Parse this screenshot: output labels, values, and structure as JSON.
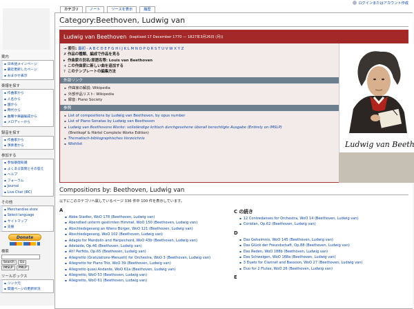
{
  "personal": {
    "login": "ログインまたはアカウント作成"
  },
  "tabs": [
    "カテゴリ",
    "ノート",
    "ソースを表示",
    "履歴"
  ],
  "sidebar": {
    "nav_title": "案内",
    "nav_items": [
      "日本語メインページ",
      "最近更新したページ",
      "おまかせ表示"
    ],
    "browse_title": "楽譜を探す",
    "browse_items": [
      "作曲家から",
      "人名から",
      "国から",
      "時代から",
      "曲種や楽器編成から",
      "メロディーから"
    ],
    "recordings_title": "録音を探す",
    "recordings_items": [
      "作曲家から",
      "演奏者から"
    ],
    "participate_title": "参加する",
    "participate_items": [
      "参加基礎知識",
      "よくある質問とその答え",
      "ヘルプ",
      "フォーラム",
      "Journal",
      "Live Chat (IRC)"
    ],
    "other_title": "その他",
    "other_items": [
      "Merchandise store",
      "Select language",
      "サイトマップ",
      "支援"
    ],
    "donate_label": "Donate",
    "search_title": "検索",
    "search_button": "Search",
    "go_button": "Go",
    "imslp_button": "IMSLP",
    "pmlp_button": "PMLP",
    "toolbox_title": "ツールボックス",
    "toolbox_items": [
      "リンク元",
      "関連ページの更新状況"
    ]
  },
  "page_title": "Category:Beethoven, Ludwig van",
  "infobox": {
    "name": "Ludwig van Beethoven",
    "dates": "(baptised 17 December 1770 — 1827年3月26日 (月))",
    "index_label": "→ 索引:",
    "index_letters": "最初 - A B C D E F G H I J K L M N O P Q R S T U V W X Y Z",
    "genre_label": "作品の種類、編成で作品を見る",
    "alias_label": "作曲家の別名/原語名等:",
    "alias_value": "Louis van Beethoven",
    "add_composer_label": "この作曲家に新しい曲を追加する",
    "template_label": "このテンプレートの編集方法",
    "external_head": "外部リンク",
    "external_items": [
      "作曲家の解説: Wikipedia",
      "外部作品リスト: Wikipedia",
      "録音: Piano Society"
    ],
    "ref_head": "参照",
    "ref_items": [
      "List of compositions by Ludwig van Beethoven, by opus number",
      "List of Piano Sonatas by Ludwig van Beethoven",
      "Ludwig van Beethovens Werke: vollständige kritisch durchgesehene überall berechtigte Ausgabe (Entirely on IMSLP)",
      "(Breitkopf & Härtel Complete Works Edition)",
      "Thematisch-bibliographisches Verzeichnis",
      "Wishlist"
    ]
  },
  "compositions": {
    "title": "Compositions by: Beethoven, Ludwig van",
    "summary": "以下にこのカテゴリへ属しているページ 336 件中 100 件を表示しています。",
    "col1_head": "A",
    "col1_items": [
      "Abbe Stadler, WoO 178 (Beethoven, Ludwig van)",
      "Abendlied unterm gestirnten Himmel, WoO 150 (Beethoven, Ludwig van)",
      "Abschiedsgesang an Wiens Bürger, WoO 121 (Beethoven, Ludwig van)",
      "Abschiedsgesang, WoO 102 (Beethoven, Ludwig van)",
      "Adagio for Mandolin and Harpsichord, WoO 43b (Beethoven, Ludwig van)",
      "Adelaide, Op.46 (Beethoven, Ludwig van)",
      "Ah! Perfido, Op.65 (Beethoven, Ludwig van)",
      "Allegretto (Gratulations-Menuett) for Orchestra, WoO 3 (Beethoven, Ludwig van)",
      "Allegretto for Piano Trio, WoO 39 (Beethoven, Ludwig van)",
      "Allegretto quasi Andante, WoO 61a (Beethoven, Ludwig van)",
      "Allegretto, WoO 53 (Beethoven, Ludwig van)",
      "Allegretto, WoO 61 (Beethoven, Ludwig van)"
    ],
    "col2_head": "C の続き",
    "col2_items": [
      "12 Contredanses for Orchestra, WoO 14 (Beethoven, Ludwig van)",
      "Coriolan, Op.62 (Beethoven, Ludwig van)"
    ],
    "col2_head2": "D",
    "col2_items2": [
      "Das Geheimnis, WoO 145 (Beethoven, Ludwig van)",
      "Das Glück der Freundschaft, Op.88 (Beethoven, Ludwig van)",
      "Das Reden, WoO 188b (Beethoven, Ludwig van)",
      "Das Schweigen, WoO 168a (Beethoven, Ludwig van)",
      "3 Duets for Clarinet and Bassoon, WoO 27 (Beethoven, Ludwig van)",
      "Duo for 2 Flutes, WoO 26 (Beethoven, Ludwig van)"
    ],
    "col2_head3": "E"
  },
  "signature_text": "Ludwig van Beethoven"
}
